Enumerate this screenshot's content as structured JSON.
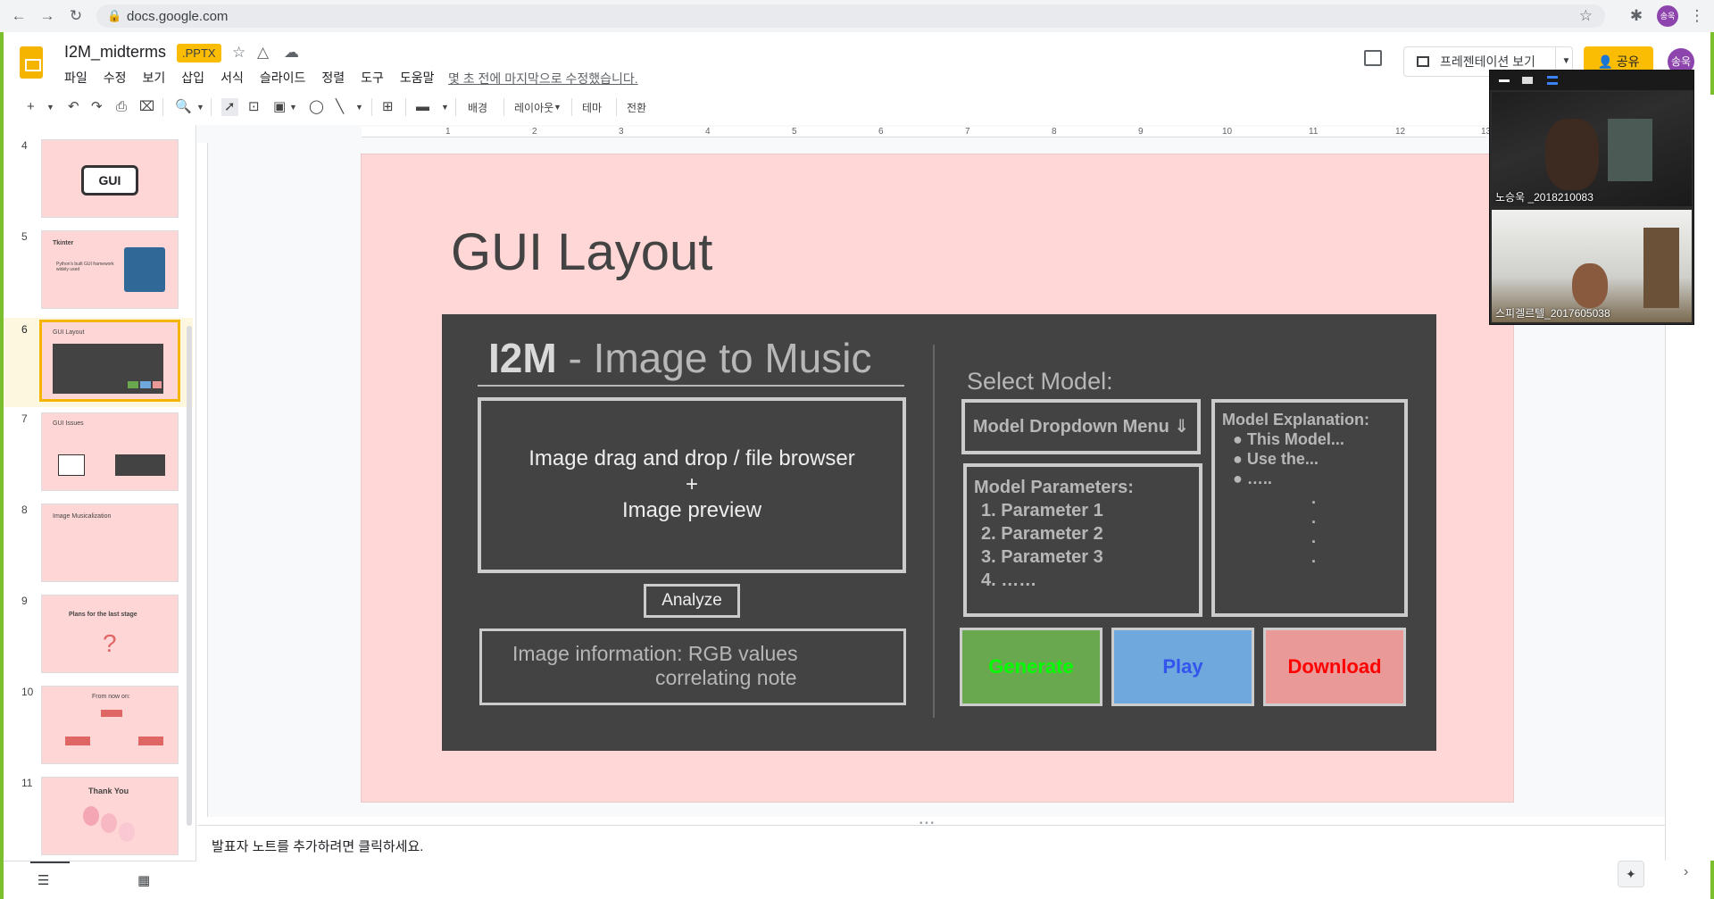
{
  "browser": {
    "url": "docs.google.com",
    "profile_initial": "송욱"
  },
  "doc": {
    "title": "I2M_midterms",
    "badge": ".PPTX",
    "last_edit": "몇 초 전에 마지막으로 수정했습니다."
  },
  "menu": [
    "파일",
    "수정",
    "보기",
    "삽입",
    "서식",
    "슬라이드",
    "정렬",
    "도구",
    "도움말"
  ],
  "header": {
    "present_label": "프레젠테이션 보기",
    "share_label": "공유",
    "avatar_initial": "송욱"
  },
  "toolbar": {
    "background": "배경",
    "layout": "레이아웃",
    "theme": "테마",
    "transition": "전환"
  },
  "ruler": {
    "marks": [
      "1",
      "2",
      "3",
      "4",
      "5",
      "6",
      "7",
      "8",
      "9",
      "10",
      "11",
      "12",
      "13"
    ]
  },
  "filmstrip": [
    {
      "num": "4",
      "label": "GUI"
    },
    {
      "num": "5",
      "label": "Tkinter",
      "sub": "Python's built GUI framework widely used"
    },
    {
      "num": "6",
      "label": "GUI Layout",
      "selected": true
    },
    {
      "num": "7",
      "label": "GUI Issues"
    },
    {
      "num": "8",
      "label": "Image Musicalization"
    },
    {
      "num": "9",
      "label": "Plans for the last stage",
      "sub": "?"
    },
    {
      "num": "10",
      "label": "From now on:"
    },
    {
      "num": "11",
      "label": "Thank You"
    }
  ],
  "slide": {
    "title": "GUI Layout",
    "app_name_bold": "I2M",
    "app_name_rest": " - Image to Music",
    "drop_line1": "Image drag and drop / file browser",
    "drop_line2": "+",
    "drop_line3": "Image preview",
    "analyze": "Analyze",
    "info_line1": "Image information: RGB values",
    "info_line2": "correlating note",
    "select_model": "Select Model:",
    "dropdown": "Model Dropdown Menu ⇓",
    "params_title": "Model Parameters:",
    "params": [
      "1.    Parameter 1",
      "2.    Parameter 2",
      "3.    Parameter 3",
      "4.    ……"
    ],
    "expl_title": "Model Explanation:",
    "expl_items": [
      "●     This Model...",
      "●     Use the...",
      "●     ….."
    ],
    "expl_dots": ".",
    "generate": "Generate",
    "play": "Play",
    "download": "Download"
  },
  "video": {
    "participant1": "노승욱 _2018210083",
    "participant2": "스피겔르텔_2017605038"
  },
  "notes": {
    "placeholder": "발표자 노트를 추가하려면 클릭하세요."
  },
  "colors": {
    "brand": "#f4b400",
    "slide_bg": "#ffd7d7",
    "dark_box": "#434343",
    "generate": "#6aa84f",
    "play": "#6fa8dc",
    "download": "#ea9999"
  }
}
